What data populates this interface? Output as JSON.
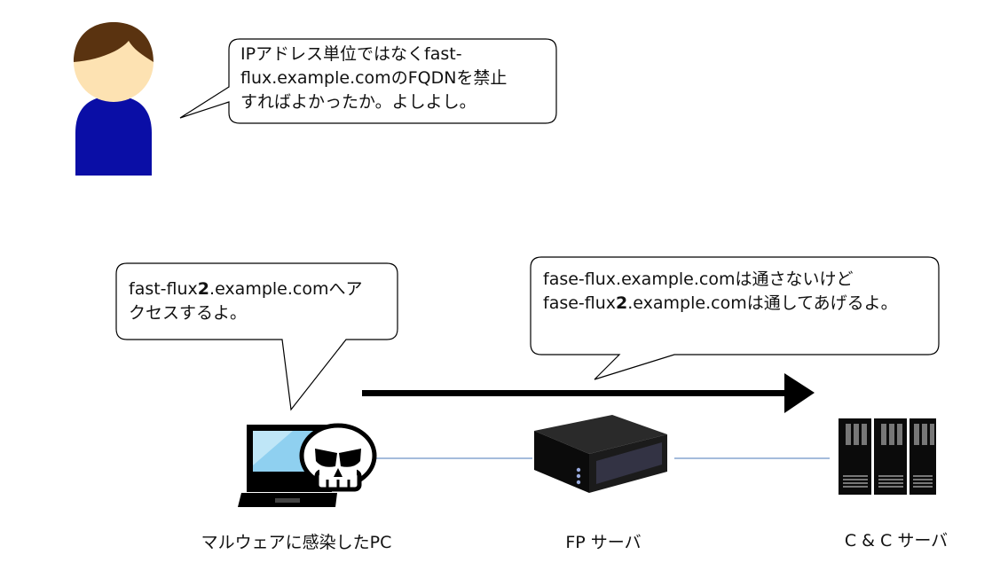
{
  "bubbles": {
    "user": {
      "line1": "IPアドレス単位ではなくfast-",
      "line2": "flux.example.comのFQDNを禁止",
      "line3": "すればよかったか。よしよし。"
    },
    "pc": {
      "line1_pre": "fast-flux",
      "line1_bold": "2",
      "line1_post": ".example.comへア",
      "line2": "クセスするよ。"
    },
    "server": {
      "line1": "fase-flux.example.comは通さないけど",
      "line2_pre": "fase-flux",
      "line2_bold": "2",
      "line2_post": ".example.comは通してあげるよ。"
    }
  },
  "nodes": {
    "pc_label": "マルウェアに感染したPC",
    "fp_label": "FP サーバ",
    "cc_label": "C & C サーバ"
  },
  "colors": {
    "shirt": "#0a0ea6",
    "hair": "#5a3310",
    "skin": "#fde2b2",
    "screen": "#8fd0f0",
    "link": "#4a78b8",
    "arrow": "#000000"
  }
}
